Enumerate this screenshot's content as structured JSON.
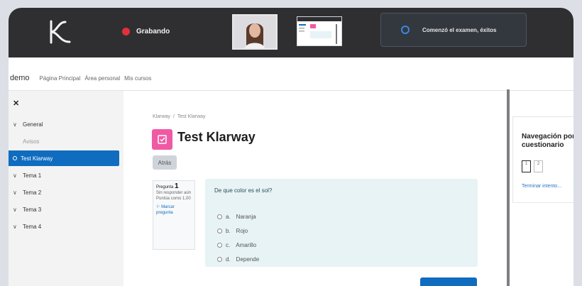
{
  "proctor_bar": {
    "recording_label": "Grabando",
    "notification": "Comenzó el examen, éxitos",
    "colors": {
      "bar": "#2f2f31",
      "recording_dot": "#e0323a",
      "notification_icon": "#3a87e0"
    }
  },
  "navbar": {
    "brand": "demo",
    "links": [
      "Página Principal",
      "Área personal",
      "Mis cursos"
    ]
  },
  "drawer": {
    "close_icon": "close-icon",
    "items": [
      {
        "label": "General",
        "type": "section"
      },
      {
        "label": "Avisos",
        "type": "sub"
      },
      {
        "label": "Test Klarway",
        "type": "active"
      },
      {
        "label": "Tema 1",
        "type": "section"
      },
      {
        "label": "Tema 2",
        "type": "section"
      },
      {
        "label": "Tema 3",
        "type": "section"
      },
      {
        "label": "Tema 4",
        "type": "section"
      }
    ]
  },
  "main": {
    "breadcrumb": [
      "Klarway",
      "Test Klarway"
    ],
    "title": "Test Klarway",
    "back_button": "Atrás",
    "question_info": {
      "label": "Pregunta",
      "number": "1",
      "status": "Sin responder aún",
      "mark": "Puntúa como 1,00",
      "flag": "Marcar pregunta"
    },
    "question": {
      "text": "De que color es el sol?",
      "options": [
        {
          "letter": "a.",
          "text": "Naranja"
        },
        {
          "letter": "b.",
          "text": "Rojo"
        },
        {
          "letter": "c.",
          "text": "Amarillo"
        },
        {
          "letter": "d.",
          "text": "Depende"
        }
      ]
    }
  },
  "quiz_nav": {
    "title": "Navegación por cuestionario",
    "buttons": [
      "1",
      "2"
    ],
    "finish_link": "Terminar intento..."
  },
  "accent_color": "#0f6cbf",
  "page_icon_color": "#f05aa4"
}
